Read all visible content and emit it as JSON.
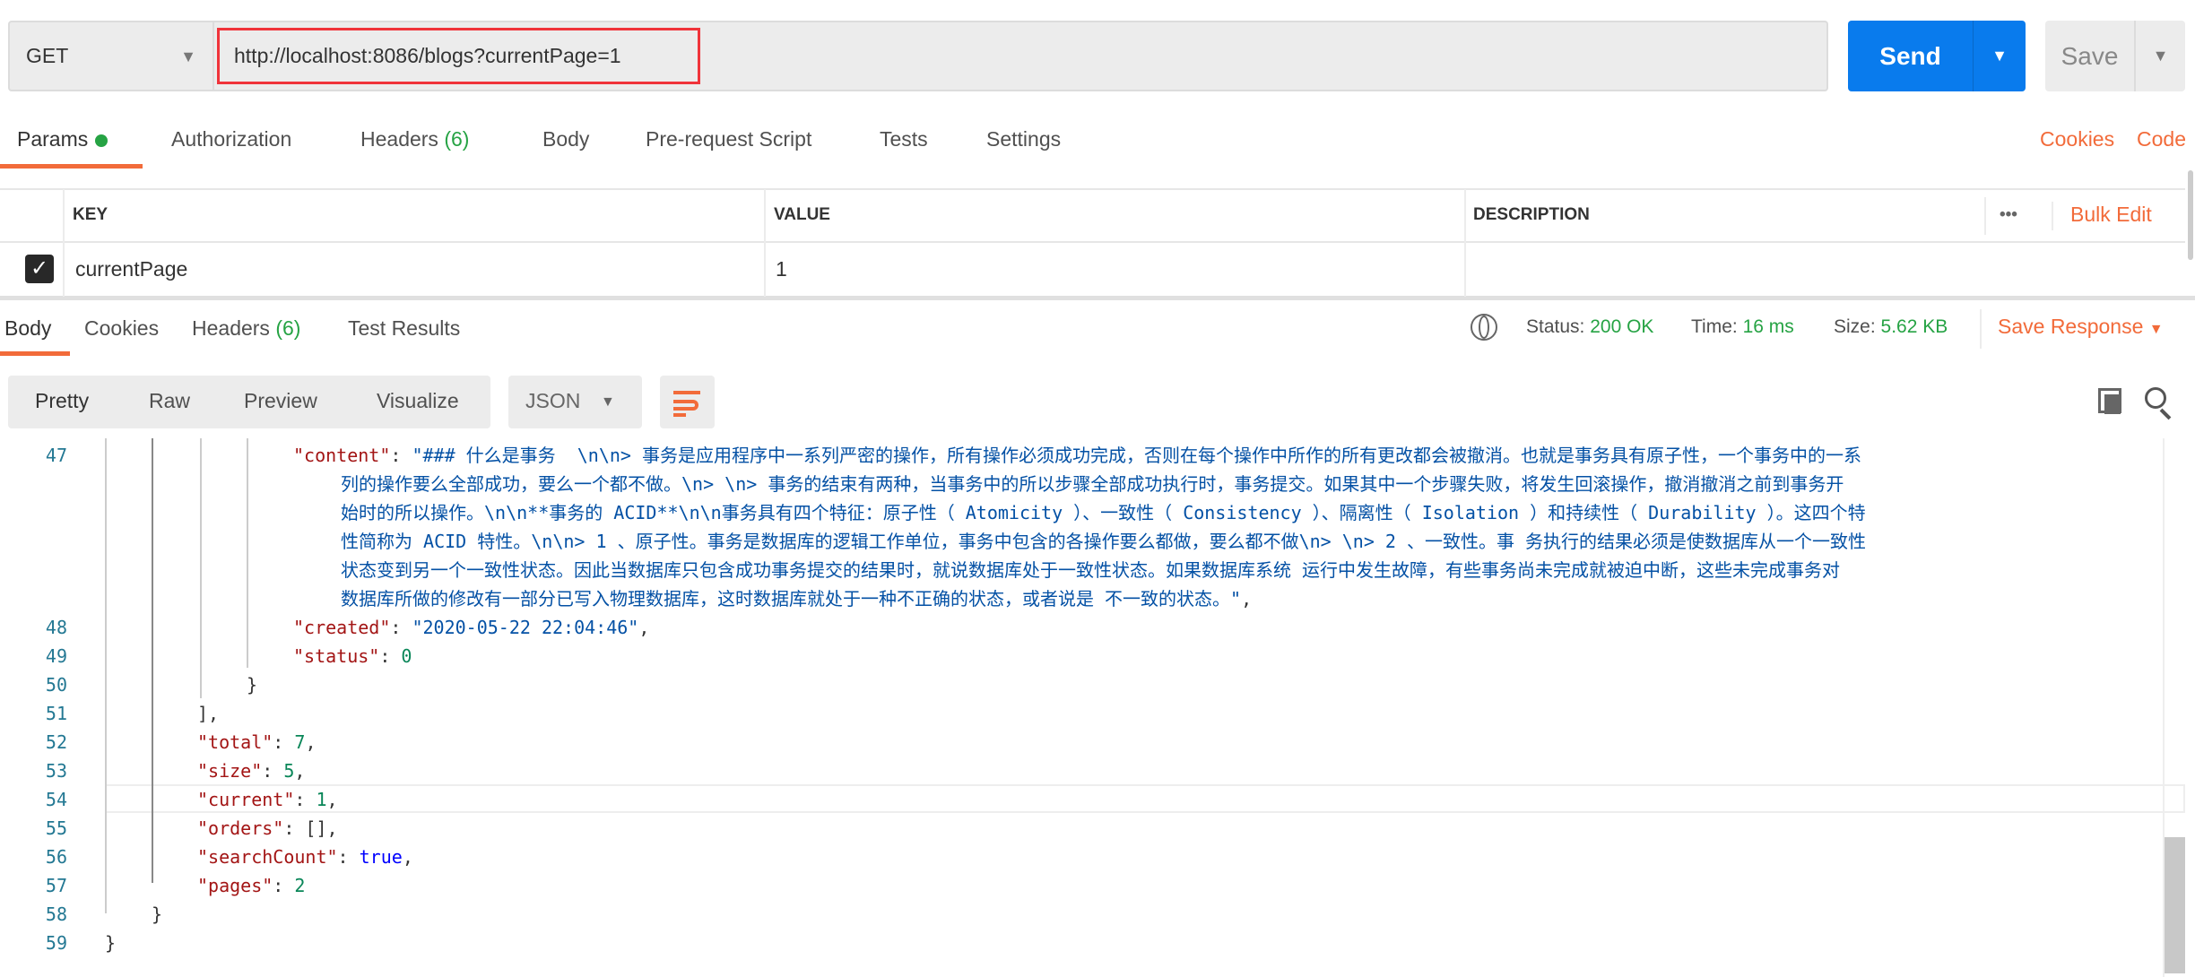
{
  "request": {
    "method": "GET",
    "url": "http://localhost:8086/blogs?currentPage=1",
    "send_label": "Send",
    "save_label": "Save"
  },
  "request_tabs": [
    {
      "label": "Params",
      "active": true,
      "dot": true
    },
    {
      "label": "Authorization"
    },
    {
      "label": "Headers",
      "count": "(6)"
    },
    {
      "label": "Body"
    },
    {
      "label": "Pre-request Script"
    },
    {
      "label": "Tests"
    },
    {
      "label": "Settings"
    }
  ],
  "request_links": {
    "cookies": "Cookies",
    "code": "Code"
  },
  "params_table": {
    "headers": [
      "KEY",
      "VALUE",
      "DESCRIPTION"
    ],
    "bulk_edit": "Bulk Edit",
    "more": "•••",
    "rows": [
      {
        "checked": true,
        "key": "currentPage",
        "value": "1",
        "description": ""
      }
    ]
  },
  "response_tabs": [
    {
      "label": "Body",
      "active": true
    },
    {
      "label": "Cookies"
    },
    {
      "label": "Headers",
      "count": "(6)"
    },
    {
      "label": "Test Results"
    }
  ],
  "response_meta": {
    "status_label": "Status:",
    "status": "200 OK",
    "time_label": "Time:",
    "time": "16 ms",
    "size_label": "Size:",
    "size": "5.62 KB",
    "save_response": "Save Response"
  },
  "view_modes": [
    "Pretty",
    "Raw",
    "Preview",
    "Visualize"
  ],
  "format": "JSON",
  "colors": {
    "accent": "#f26b3a",
    "send": "#097bed",
    "success": "#26a344"
  },
  "code": {
    "highlighted_line": 54,
    "lines": [
      {
        "num": "47",
        "level": 3,
        "tokens": [
          [
            "k",
            "\"content\""
          ],
          [
            "p",
            ": "
          ],
          [
            "s",
            "\"### 什么是事务  \\n\\n> 事务是应用程序中一系列严密的操作，所有操作必须成功完成，否则在每个操作中所作的所有更改都会被撤消。也就是事务具有原子性，一个事务中的一系"
          ]
        ]
      },
      {
        "num": "",
        "level": 4,
        "tokens": [
          [
            "s",
            "列的操作要么全部成功，要么一个都不做。\\n> \\n> 事务的结束有两种，当事务中的所以步骤全部成功执行时，事务提交。如果其中一个步骤失败，将发生回滚操作，撤消撤消之前到事务开"
          ]
        ]
      },
      {
        "num": "",
        "level": 4,
        "tokens": [
          [
            "s",
            "始时的所以操作。\\n\\n**事务的 ACID**\\n\\n事务具有四个特征：原子性（ Atomicity ）、一致性（ Consistency ）、隔离性（ Isolation ）和持续性（ Durability ）。这四个特"
          ]
        ]
      },
      {
        "num": "",
        "level": 4,
        "tokens": [
          [
            "s",
            "性简称为 ACID 特性。\\n\\n> 1 、原子性。事务是数据库的逻辑工作单位，事务中包含的各操作要么都做，要么都不做\\n> \\n> 2 、一致性。事 务执行的结果必须是使数据库从一个一致性"
          ]
        ]
      },
      {
        "num": "",
        "level": 4,
        "tokens": [
          [
            "s",
            "状态变到另一个一致性状态。因此当数据库只包含成功事务提交的结果时，就说数据库处于一致性状态。如果数据库系统 运行中发生故障，有些事务尚未完成就被迫中断，这些未完成事务对"
          ]
        ]
      },
      {
        "num": "",
        "level": 4,
        "tokens": [
          [
            "s",
            "数据库所做的修改有一部分已写入物理数据库，这时数据库就处于一种不正确的状态，或者说是 不一致的状态。\""
          ],
          [
            "p",
            ","
          ]
        ]
      },
      {
        "num": "48",
        "level": 3,
        "tokens": [
          [
            "k",
            "\"created\""
          ],
          [
            "p",
            ": "
          ],
          [
            "s",
            "\"2020-05-22 22:04:46\""
          ],
          [
            "p",
            ","
          ]
        ]
      },
      {
        "num": "49",
        "level": 3,
        "tokens": [
          [
            "k",
            "\"status\""
          ],
          [
            "p",
            ": "
          ],
          [
            "n",
            "0"
          ]
        ]
      },
      {
        "num": "50",
        "level": 2,
        "tokens": [
          [
            "p",
            "}"
          ]
        ]
      },
      {
        "num": "51",
        "level": 1,
        "tokens": [
          [
            "p",
            "],"
          ]
        ]
      },
      {
        "num": "52",
        "level": 1,
        "tokens": [
          [
            "k",
            "\"total\""
          ],
          [
            "p",
            ": "
          ],
          [
            "n",
            "7"
          ],
          [
            "p",
            ","
          ]
        ]
      },
      {
        "num": "53",
        "level": 1,
        "tokens": [
          [
            "k",
            "\"size\""
          ],
          [
            "p",
            ": "
          ],
          [
            "n",
            "5"
          ],
          [
            "p",
            ","
          ]
        ]
      },
      {
        "num": "54",
        "level": 1,
        "tokens": [
          [
            "k",
            "\"current\""
          ],
          [
            "p",
            ": "
          ],
          [
            "n",
            "1"
          ],
          [
            "p",
            ","
          ]
        ]
      },
      {
        "num": "55",
        "level": 1,
        "tokens": [
          [
            "k",
            "\"orders\""
          ],
          [
            "p",
            ": []"
          ],
          [
            "p",
            ","
          ]
        ]
      },
      {
        "num": "56",
        "level": 1,
        "tokens": [
          [
            "k",
            "\"searchCount\""
          ],
          [
            "p",
            ": "
          ],
          [
            "b",
            "true"
          ],
          [
            "p",
            ","
          ]
        ]
      },
      {
        "num": "57",
        "level": 1,
        "tokens": [
          [
            "k",
            "\"pages\""
          ],
          [
            "p",
            ": "
          ],
          [
            "n",
            "2"
          ]
        ]
      },
      {
        "num": "58",
        "level": 0.5,
        "tokens": [
          [
            "p",
            "}"
          ]
        ]
      },
      {
        "num": "59",
        "level": 0,
        "tokens": [
          [
            "p",
            "}"
          ]
        ]
      }
    ]
  }
}
